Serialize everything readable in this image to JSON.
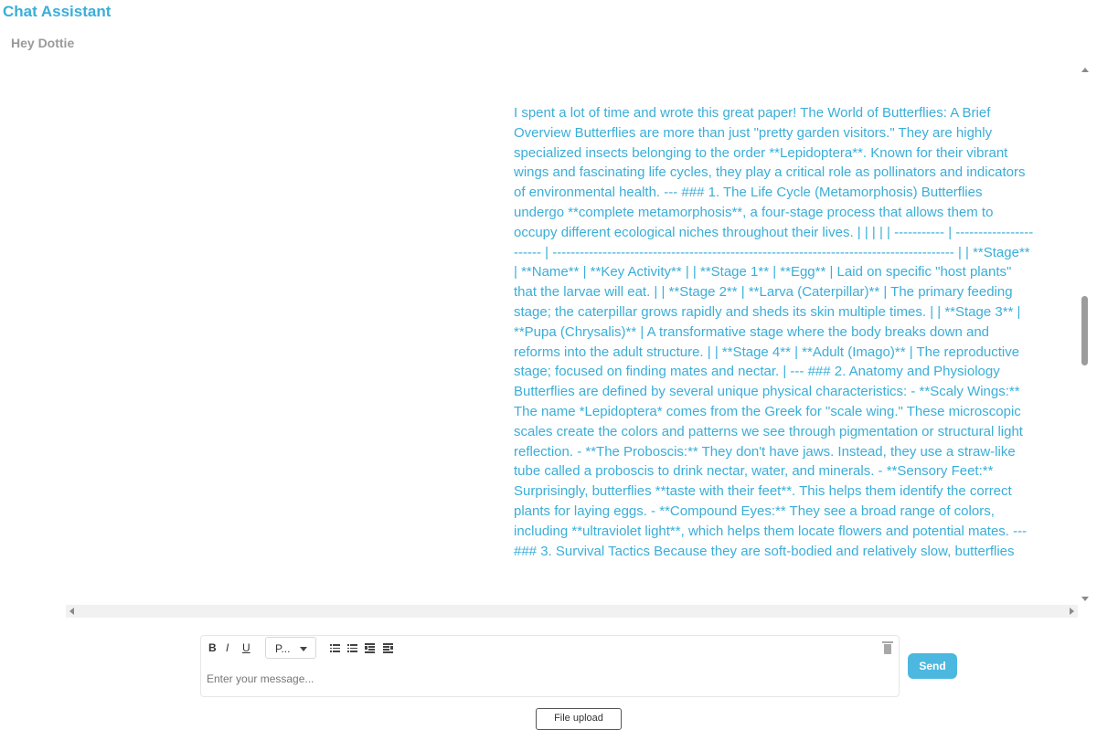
{
  "app": {
    "title": "Chat Assistant"
  },
  "chat": {
    "name": "Hey Dottie"
  },
  "messages": [
    {
      "role": "user",
      "text": "I spent a lot of time and wrote this great paper! The World of Butterflies: A Brief Overview Butterflies are more than just \"pretty garden visitors.\" They are highly specialized insects belonging to the order **Lepidoptera**. Known for their vibrant wings and fascinating life cycles, they play a critical role as pollinators and indicators of environmental health. --- ### 1. The Life Cycle (Metamorphosis) Butterflies undergo **complete metamorphosis**, a four-stage process that allows them to occupy different ecological niches throughout their lives. | | | | | ----------- | ----------------------- | ---------------------------------------------------------------------------------------- | | **Stage** | **Name** | **Key Activity** | | **Stage 1** | **Egg** | Laid on specific \"host plants\" that the larvae will eat. | | **Stage 2** | **Larva (Caterpillar)** | The primary feeding stage; the caterpillar grows rapidly and sheds its skin multiple times. | | **Stage 3** | **Pupa (Chrysalis)** | A transformative stage where the body breaks down and reforms into the adult structure. | | **Stage 4** | **Adult (Imago)** | The reproductive stage; focused on finding mates and nectar. | --- ### 2. Anatomy and Physiology Butterflies are defined by several unique physical characteristics: - **Scaly Wings:** The name *Lepidoptera* comes from the Greek for \"scale wing.\" These microscopic scales create the colors and patterns we see through pigmentation or structural light reflection. - **The Proboscis:** They don't have jaws. Instead, they use a straw-like tube called a proboscis to drink nectar, water, and minerals. - **Sensory Feet:** Surprisingly, butterflies **taste with their feet**. This helps them identify the correct plants for laying eggs. - **Compound Eyes:** They see a broad range of colors, including **ultraviolet light**, which helps them locate flowers and potential mates. --- ### 3. Survival Tactics Because they are soft-bodied and relatively slow, butterflies"
    }
  ],
  "composer": {
    "bold_label": "B",
    "italic_label": "I",
    "underline_label": "U",
    "paragraph_select_value": "P...",
    "placeholder": "Enter your message...",
    "send_label": "Send",
    "file_upload_label": "File upload"
  },
  "colors": {
    "accent": "#3aaed8",
    "send_button": "#4cb8e0",
    "subtitle": "#9a9a9a"
  },
  "icons": {
    "bullet_list": "bullet-list-icon",
    "numbered_list": "numbered-list-icon",
    "indent": "indent-icon",
    "outdent": "outdent-icon",
    "trash": "trash-icon"
  }
}
